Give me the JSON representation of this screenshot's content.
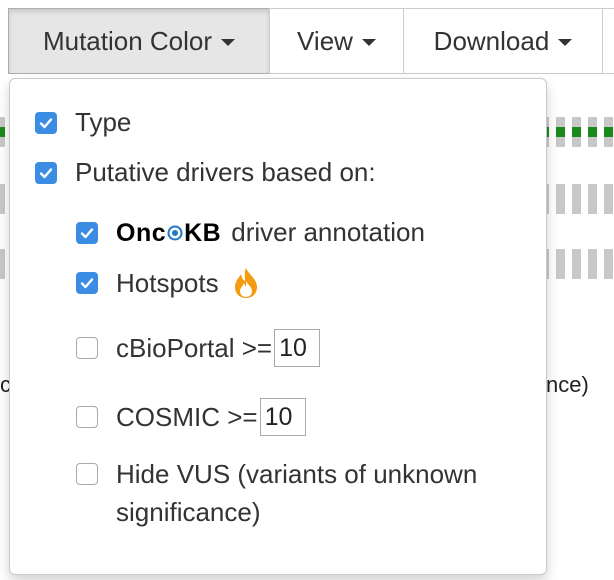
{
  "toolbar": {
    "mutation_color_label": "Mutation Color",
    "view_label": "View",
    "download_label": "Download"
  },
  "background": {
    "partial_text_left": "c",
    "partial_text_right": "nce)"
  },
  "dropdown": {
    "type_label": "Type",
    "putative_label": "Putative drivers based on:",
    "oncokb_logo_text_left": "Onc",
    "oncokb_logo_text_right": "KB",
    "oncokb_label": "driver annotation",
    "hotspots_label": "Hotspots",
    "cbioportal_label": "cBioPortal >=",
    "cbioportal_value": "10",
    "cosmic_label": "COSMIC >=",
    "cosmic_value": "10",
    "hide_vus_label": "Hide VUS (variants of unknown significance)"
  },
  "checkbox_states": {
    "type": true,
    "putative": true,
    "oncokb": true,
    "hotspots": true,
    "cbioportal": false,
    "cosmic": false,
    "hide_vus": false
  },
  "icons": {
    "caret": "caret-down-icon",
    "checkmark": "checkmark-icon",
    "flame": "flame-icon"
  },
  "colors": {
    "checkbox_blue": "#3b8de3",
    "mutation_green": "#1a8a1a",
    "track_gray": "#c8c8c8",
    "flame_orange": "#f39c12"
  }
}
